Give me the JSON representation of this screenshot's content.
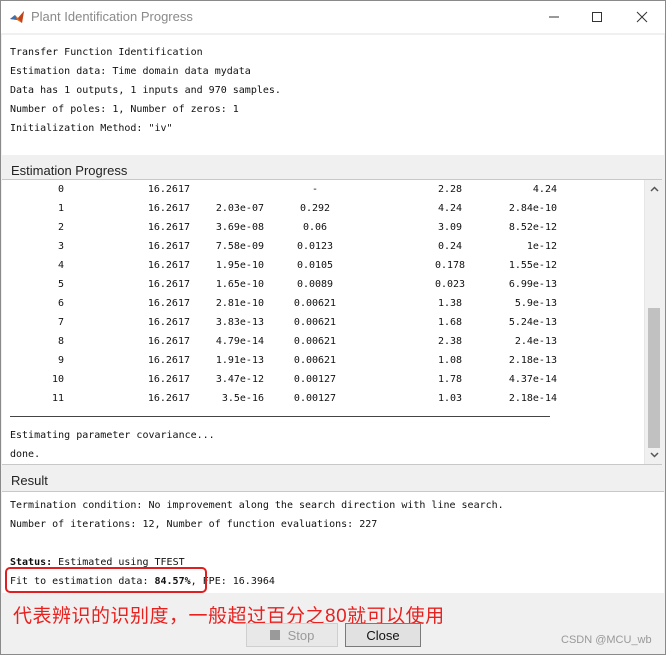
{
  "window": {
    "title": "Plant Identification Progress"
  },
  "info_lines": [
    "Transfer Function Identification",
    "Estimation data: Time domain data mydata",
    "Data has 1 outputs, 1 inputs and 970 samples.",
    "Number of poles: 1, Number of zeros: 1",
    "Initialization Method: \"iv\""
  ],
  "progress": {
    "label": "Estimation Progress",
    "rows": [
      [
        "0",
        "16.2617",
        "",
        "-",
        "2.28",
        "4.24"
      ],
      [
        "1",
        "16.2617",
        "2.03e-07",
        "0.292",
        "4.24",
        "2.84e-10"
      ],
      [
        "2",
        "16.2617",
        "3.69e-08",
        "0.06",
        "3.09",
        "8.52e-12"
      ],
      [
        "3",
        "16.2617",
        "7.58e-09",
        "0.0123",
        "0.24",
        "1e-12"
      ],
      [
        "4",
        "16.2617",
        "1.95e-10",
        "0.0105",
        "0.178",
        "1.55e-12"
      ],
      [
        "5",
        "16.2617",
        "1.65e-10",
        "0.0089",
        "0.023",
        "6.99e-13"
      ],
      [
        "6",
        "16.2617",
        "2.81e-10",
        "0.00621",
        "1.38",
        "5.9e-13"
      ],
      [
        "7",
        "16.2617",
        "3.83e-13",
        "0.00621",
        "1.68",
        "5.24e-13"
      ],
      [
        "8",
        "16.2617",
        "4.79e-14",
        "0.00621",
        "2.38",
        "2.4e-13"
      ],
      [
        "9",
        "16.2617",
        "1.91e-13",
        "0.00621",
        "1.08",
        "2.18e-13"
      ],
      [
        "10",
        "16.2617",
        "3.47e-12",
        "0.00127",
        "1.78",
        "4.37e-14"
      ],
      [
        "11",
        "16.2617",
        "3.5e-16",
        "0.00127",
        "1.03",
        "2.18e-14"
      ]
    ],
    "covariance_text": "Estimating parameter covariance...",
    "done_text": "done."
  },
  "result": {
    "label": "Result",
    "termination": "Termination condition: No improvement along the search direction with line search.",
    "iterations": "Number of iterations: 12, Number of function evaluations: 227",
    "status_label": "Status:",
    "status_value": " Estimated using TFEST",
    "fit_label": "Fit to estimation data: ",
    "fit_value": "84.57%",
    "fpe_text": ", FPE: 16.3964"
  },
  "annotation": "代表辨识的识别度，一般超过百分之80就可以使用",
  "buttons": {
    "stop": "Stop",
    "close": "Close"
  },
  "watermark": "CSDN @MCU_wb",
  "colors": {
    "annotation": "#e8211f",
    "highlight_border": "#e02020"
  }
}
